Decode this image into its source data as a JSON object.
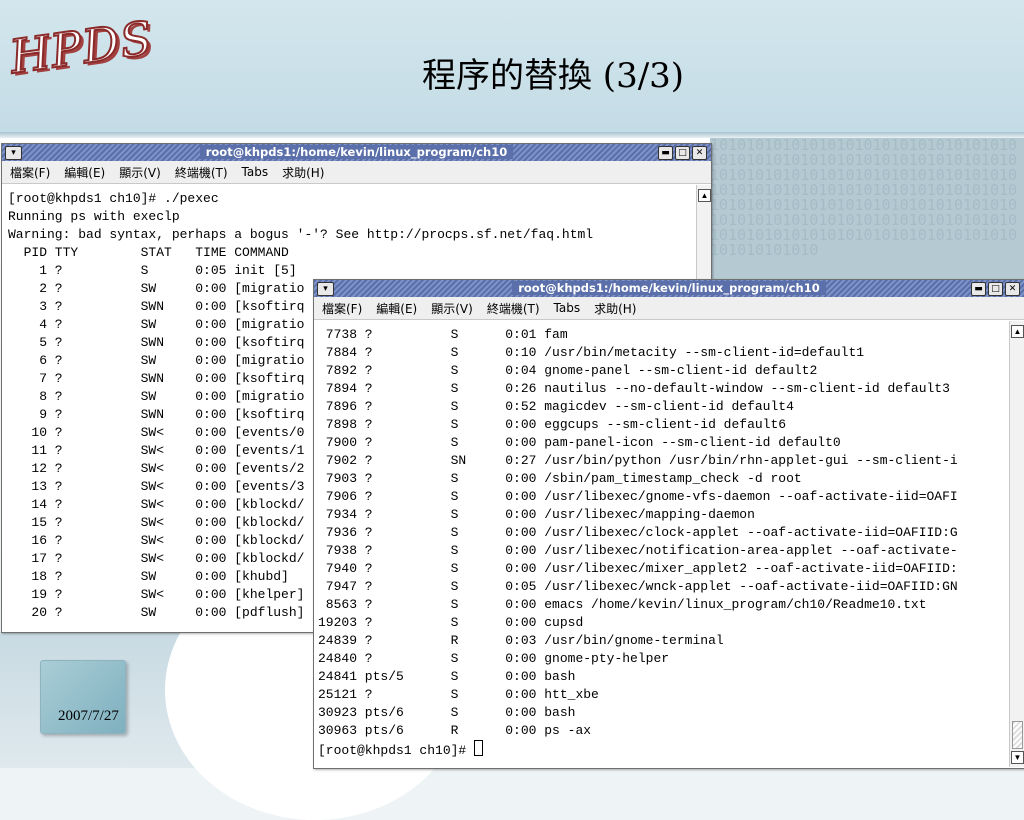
{
  "slide": {
    "logo": "HPDS",
    "title": "程序的替換 (3/3)",
    "date": "2007/7/27",
    "binary_pattern": "1010101010101010101010101010101010101010101010101010101010101010101010101010101010101010101010101010101010101010101010101010101010101010101010101010101010101010101010101010101010101010101010101010101010101010101010101010101010101010101010101010101010"
  },
  "menu": {
    "file": "檔案(F)",
    "edit": "編輯(E)",
    "view": "顯示(V)",
    "terminal": "終端機(T)",
    "tabs": "Tabs",
    "help": "求助(H)"
  },
  "window1": {
    "title": "root@khpds1:/home/kevin/linux_program/ch10",
    "lines": [
      "[root@khpds1 ch10]# ./pexec",
      "Running ps with execlp",
      "Warning: bad syntax, perhaps a bogus '-'? See http://procps.sf.net/faq.html",
      "  PID TTY        STAT   TIME COMMAND",
      "    1 ?          S      0:05 init [5]",
      "    2 ?          SW     0:00 [migratio",
      "    3 ?          SWN    0:00 [ksoftirq",
      "    4 ?          SW     0:00 [migratio",
      "    5 ?          SWN    0:00 [ksoftirq",
      "    6 ?          SW     0:00 [migratio",
      "    7 ?          SWN    0:00 [ksoftirq",
      "    8 ?          SW     0:00 [migratio",
      "    9 ?          SWN    0:00 [ksoftirq",
      "   10 ?          SW<    0:00 [events/0",
      "   11 ?          SW<    0:00 [events/1",
      "   12 ?          SW<    0:00 [events/2",
      "   13 ?          SW<    0:00 [events/3",
      "   14 ?          SW<    0:00 [kblockd/",
      "   15 ?          SW<    0:00 [kblockd/",
      "   16 ?          SW<    0:00 [kblockd/",
      "   17 ?          SW<    0:00 [kblockd/",
      "   18 ?          SW     0:00 [khubd]",
      "   19 ?          SW<    0:00 [khelper]",
      "   20 ?          SW     0:00 [pdflush]"
    ]
  },
  "window2": {
    "title": "root@khpds1:/home/kevin/linux_program/ch10",
    "lines": [
      " 7738 ?          S      0:01 fam",
      " 7884 ?          S      0:10 /usr/bin/metacity --sm-client-id=default1",
      " 7892 ?          S      0:04 gnome-panel --sm-client-id default2",
      " 7894 ?          S      0:26 nautilus --no-default-window --sm-client-id default3",
      " 7896 ?          S      0:52 magicdev --sm-client-id default4",
      " 7898 ?          S      0:00 eggcups --sm-client-id default6",
      " 7900 ?          S      0:00 pam-panel-icon --sm-client-id default0",
      " 7902 ?          SN     0:27 /usr/bin/python /usr/bin/rhn-applet-gui --sm-client-i",
      " 7903 ?          S      0:00 /sbin/pam_timestamp_check -d root",
      " 7906 ?          S      0:00 /usr/libexec/gnome-vfs-daemon --oaf-activate-iid=OAFI",
      " 7934 ?          S      0:00 /usr/libexec/mapping-daemon",
      " 7936 ?          S      0:00 /usr/libexec/clock-applet --oaf-activate-iid=OAFIID:G",
      " 7938 ?          S      0:00 /usr/libexec/notification-area-applet --oaf-activate-",
      " 7940 ?          S      0:00 /usr/libexec/mixer_applet2 --oaf-activate-iid=OAFIID:",
      " 7947 ?          S      0:05 /usr/libexec/wnck-applet --oaf-activate-iid=OAFIID:GN",
      " 8563 ?          S      0:00 emacs /home/kevin/linux_program/ch10/Readme10.txt",
      "19203 ?          S      0:00 cupsd",
      "24839 ?          R      0:03 /usr/bin/gnome-terminal",
      "24840 ?          S      0:00 gnome-pty-helper",
      "24841 pts/5      S      0:00 bash",
      "25121 ?          S      0:00 htt_xbe",
      "30923 pts/6      S      0:00 bash",
      "30963 pts/6      R      0:00 ps -ax"
    ],
    "prompt": "[root@khpds1 ch10]# "
  }
}
